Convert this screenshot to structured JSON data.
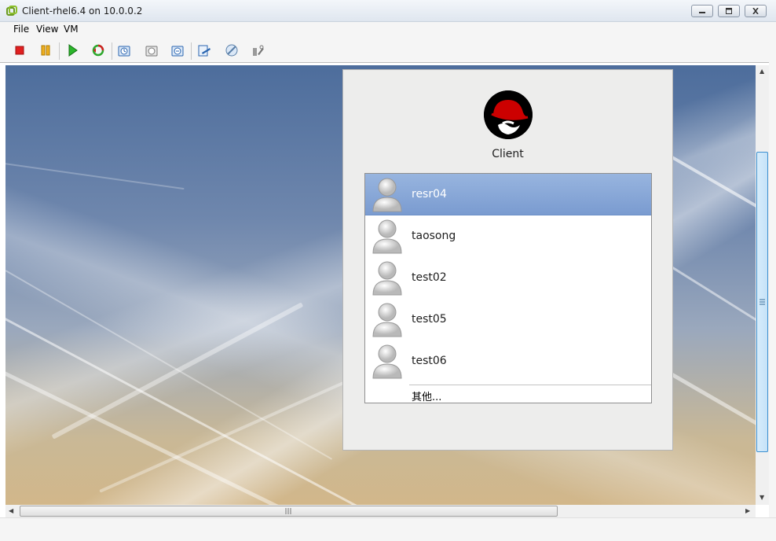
{
  "window": {
    "title": "Client-rhel6.4 on 10.0.0.2"
  },
  "menu": {
    "items": [
      "File",
      "View",
      "VM"
    ]
  },
  "toolbar": {
    "icons": [
      "stop-icon",
      "pause-icon",
      "play-icon",
      "refresh-icon",
      "snapshot-icon",
      "snapshot-manager-icon",
      "revert-snapshot-icon",
      "edit-settings-icon",
      "connect-device-icon",
      "tools-icon"
    ]
  },
  "login": {
    "host": "Client",
    "users": [
      "resr04",
      "taosong",
      "test02",
      "test05",
      "test06"
    ],
    "selected_user": "resr04",
    "other_label": "其他..."
  },
  "colors": {
    "selection": "#7a9bd0",
    "stop": "#e02020",
    "pause": "#e0a000",
    "play": "#1ea21e",
    "scroll_accent": "#3b8fd0"
  }
}
